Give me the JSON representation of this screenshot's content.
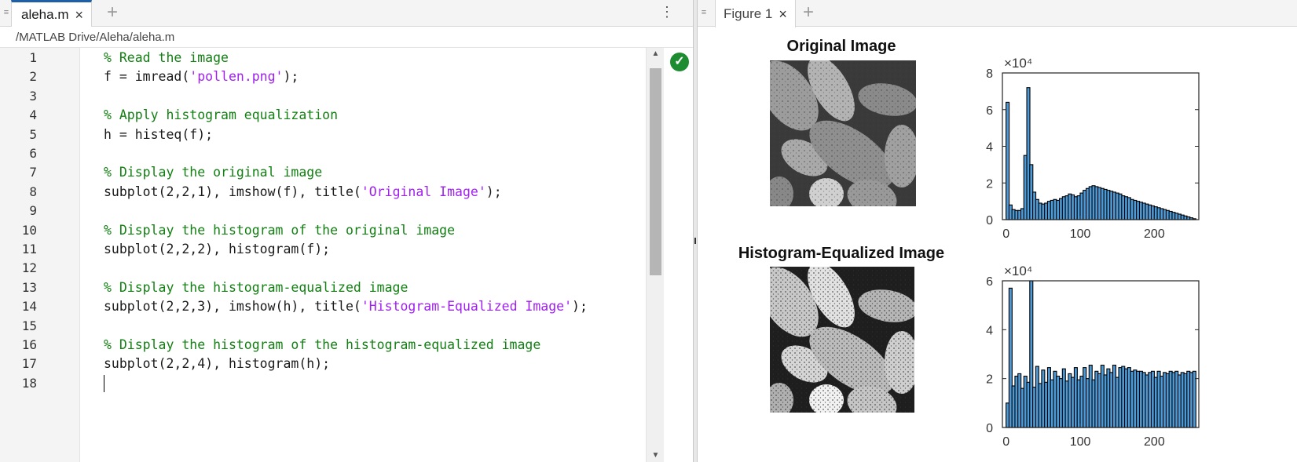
{
  "editor": {
    "tab": {
      "label": "aleha.m",
      "close": "×"
    },
    "add_tab": "+",
    "more_options": "⋮",
    "path": "/MATLAB Drive/Aleha/aleha.m",
    "status_icon": "check-circle-icon",
    "lines": [
      {
        "no": "1",
        "segments": [
          {
            "t": "% Read the image",
            "k": "comment"
          }
        ]
      },
      {
        "no": "2",
        "segments": [
          {
            "t": "f = imread(",
            "k": "code"
          },
          {
            "t": "'pollen.png'",
            "k": "string"
          },
          {
            "t": ");",
            "k": "code"
          }
        ]
      },
      {
        "no": "3",
        "segments": []
      },
      {
        "no": "4",
        "segments": [
          {
            "t": "% Apply histogram equalization",
            "k": "comment"
          }
        ]
      },
      {
        "no": "5",
        "segments": [
          {
            "t": "h = histeq(f);",
            "k": "code"
          }
        ]
      },
      {
        "no": "6",
        "segments": []
      },
      {
        "no": "7",
        "segments": [
          {
            "t": "% Display the original image",
            "k": "comment"
          }
        ]
      },
      {
        "no": "8",
        "segments": [
          {
            "t": "subplot(2,2,1), imshow(f), title(",
            "k": "code"
          },
          {
            "t": "'Original Image'",
            "k": "string"
          },
          {
            "t": ");",
            "k": "code"
          }
        ]
      },
      {
        "no": "9",
        "segments": []
      },
      {
        "no": "10",
        "segments": [
          {
            "t": "% Display the histogram of the original image",
            "k": "comment"
          }
        ]
      },
      {
        "no": "11",
        "segments": [
          {
            "t": "subplot(2,2,2), histogram(f);",
            "k": "code"
          }
        ]
      },
      {
        "no": "12",
        "segments": []
      },
      {
        "no": "13",
        "segments": [
          {
            "t": "% Display the histogram-equalized image",
            "k": "comment"
          }
        ]
      },
      {
        "no": "14",
        "segments": [
          {
            "t": "subplot(2,2,3), imshow(h), title(",
            "k": "code"
          },
          {
            "t": "'Histogram-Equalized Image'",
            "k": "string"
          },
          {
            "t": ");",
            "k": "code"
          }
        ]
      },
      {
        "no": "15",
        "segments": []
      },
      {
        "no": "16",
        "segments": [
          {
            "t": "% Display the histogram of the histogram-equalized image",
            "k": "comment"
          }
        ]
      },
      {
        "no": "17",
        "segments": [
          {
            "t": "subplot(2,2,4), histogram(h);",
            "k": "code"
          }
        ]
      },
      {
        "no": "18",
        "segments": []
      }
    ]
  },
  "figure": {
    "tab": {
      "label": "Figure 1",
      "close": "×"
    },
    "add_tab": "+",
    "subplots": [
      {
        "title": "Original Image"
      },
      {
        "title": "Histogram-Equalized Image"
      }
    ]
  },
  "colors": {
    "comment": "#128012",
    "string": "#a020f0",
    "bar_fill": "#4d9ad6",
    "tab_accent": "#1f5fa8",
    "status_ok": "#1d8b2f"
  },
  "chart_data": [
    {
      "type": "bar",
      "title": "",
      "xlabel": "",
      "ylabel": "",
      "exponent_label": "×10⁴",
      "xlim": [
        -5,
        260
      ],
      "ylim": [
        0,
        8
      ],
      "xticks": [
        0,
        100,
        200
      ],
      "yticks": [
        0,
        2,
        4,
        6,
        8
      ],
      "bin_width": 4.2,
      "bin_centers": [
        2,
        6,
        10,
        14,
        18,
        22,
        26,
        30,
        34,
        38,
        42,
        46,
        50,
        54,
        58,
        62,
        66,
        70,
        74,
        78,
        82,
        86,
        90,
        94,
        98,
        102,
        106,
        110,
        114,
        118,
        122,
        126,
        130,
        134,
        138,
        142,
        146,
        150,
        154,
        158,
        162,
        166,
        170,
        174,
        178,
        182,
        186,
        190,
        194,
        198,
        202,
        206,
        210,
        214,
        218,
        222,
        226,
        230,
        234,
        238,
        242,
        246,
        250,
        254
      ],
      "values": [
        6.4,
        0.8,
        0.55,
        0.5,
        0.5,
        0.6,
        3.5,
        7.2,
        3.0,
        1.5,
        1.1,
        0.9,
        0.85,
        0.9,
        1.0,
        1.05,
        1.1,
        1.05,
        1.15,
        1.25,
        1.3,
        1.4,
        1.35,
        1.25,
        1.3,
        1.45,
        1.6,
        1.7,
        1.8,
        1.85,
        1.8,
        1.75,
        1.7,
        1.65,
        1.6,
        1.55,
        1.5,
        1.45,
        1.4,
        1.3,
        1.25,
        1.2,
        1.1,
        1.05,
        1.0,
        0.95,
        0.9,
        0.85,
        0.8,
        0.75,
        0.7,
        0.65,
        0.6,
        0.55,
        0.5,
        0.45,
        0.4,
        0.35,
        0.3,
        0.25,
        0.2,
        0.15,
        0.1,
        0.05
      ]
    },
    {
      "type": "bar",
      "title": "",
      "xlabel": "",
      "ylabel": "",
      "exponent_label": "×10⁴",
      "xlim": [
        -5,
        260
      ],
      "ylim": [
        0,
        6
      ],
      "xticks": [
        0,
        100,
        200
      ],
      "yticks": [
        0,
        2,
        4,
        6
      ],
      "bin_width": 4.2,
      "bin_centers": [
        2,
        6,
        10,
        14,
        18,
        22,
        26,
        30,
        34,
        38,
        42,
        46,
        50,
        54,
        58,
        62,
        66,
        70,
        74,
        78,
        82,
        86,
        90,
        94,
        98,
        102,
        106,
        110,
        114,
        118,
        122,
        126,
        130,
        134,
        138,
        142,
        146,
        150,
        154,
        158,
        162,
        166,
        170,
        174,
        178,
        182,
        186,
        190,
        194,
        198,
        202,
        206,
        210,
        214,
        218,
        222,
        226,
        230,
        234,
        238,
        242,
        246,
        250,
        254
      ],
      "values": [
        1.0,
        5.7,
        1.7,
        2.1,
        2.2,
        1.6,
        2.1,
        1.85,
        6.0,
        1.65,
        2.5,
        1.8,
        2.35,
        1.85,
        2.45,
        1.95,
        2.3,
        2.1,
        2.0,
        2.4,
        1.9,
        2.2,
        2.05,
        2.45,
        1.95,
        2.1,
        2.45,
        2.0,
        2.55,
        1.95,
        2.3,
        2.2,
        2.55,
        2.15,
        2.4,
        2.25,
        2.55,
        2.05,
        2.45,
        2.5,
        2.4,
        2.45,
        2.3,
        2.35,
        2.3,
        2.3,
        2.25,
        2.15,
        2.25,
        2.3,
        2.05,
        2.3,
        2.1,
        2.25,
        2.2,
        2.3,
        2.25,
        2.3,
        2.15,
        2.25,
        2.2,
        2.3,
        2.25,
        2.3
      ]
    }
  ]
}
